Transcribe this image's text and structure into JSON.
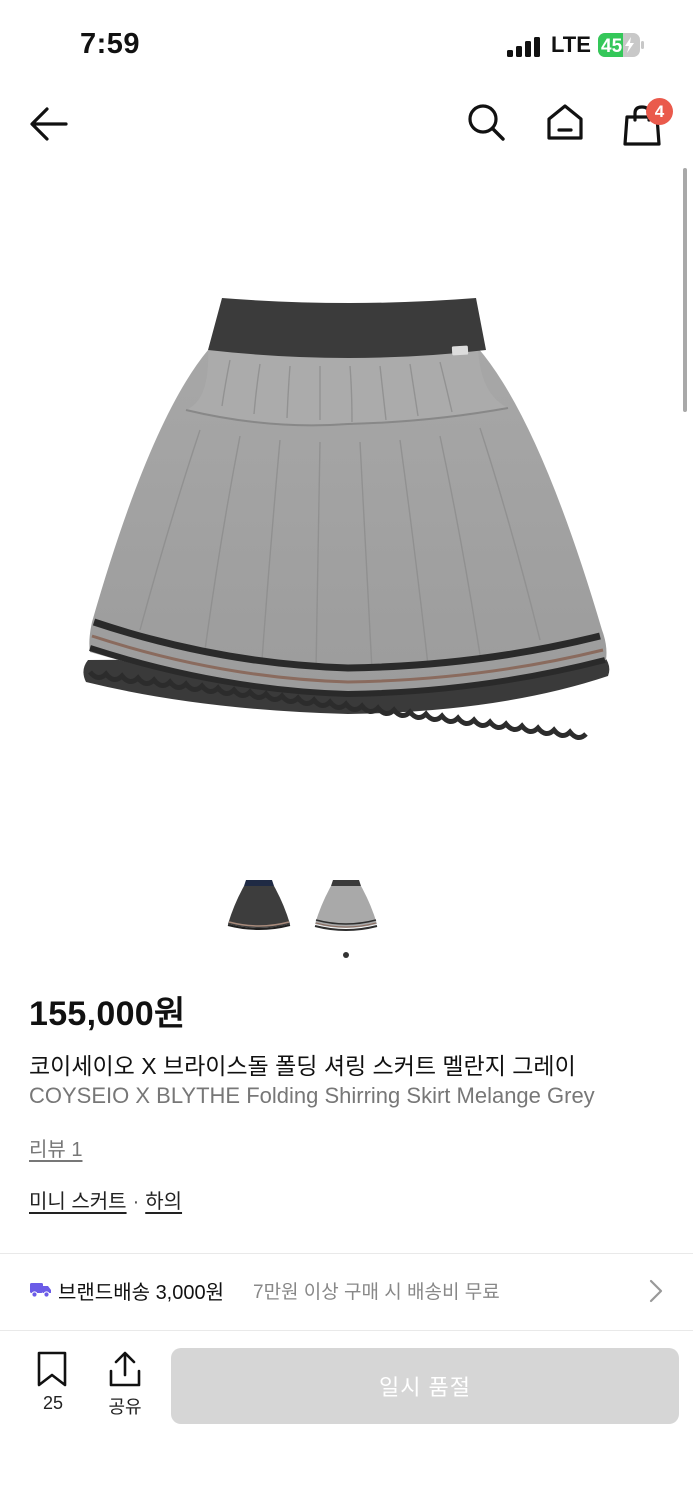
{
  "status_bar": {
    "time": "7:59",
    "network": "LTE",
    "battery_level": "45"
  },
  "header": {
    "cart_count": "4",
    "icons": [
      "back-arrow-icon",
      "search-icon",
      "home-icon",
      "shopping-bag-icon"
    ]
  },
  "gallery": {
    "main_image": "grey-pleated-skirt",
    "thumbnails": [
      "charcoal-skirt-thumbnail",
      "grey-skirt-thumbnail"
    ],
    "current_page": 1
  },
  "product": {
    "price": "155,000원",
    "name_ko": "코이세이오 X 브라이스돌 폴딩 셔링 스커트 멜란지 그레이",
    "name_en": "COYSEIO X BLYTHE Folding Shirring Skirt Melange Grey",
    "review": "리뷰 1",
    "category_1": "미니 스커트",
    "category_separator": "·",
    "category_2": "하의"
  },
  "shipping": {
    "label": "브랜드배송",
    "fee": "3,000원",
    "note": "7만원 이상 구매 시 배송비 무료",
    "icon": "truck-icon"
  },
  "bottom_bar": {
    "wishlist_count": "25",
    "share_label": "공유",
    "soldout_label": "일시 품절"
  },
  "colors": {
    "badge": "#ea5a4c",
    "button_disabled": "#d6d6d6",
    "truck": "#6b5ce7",
    "battery_fill": "#34c759"
  }
}
